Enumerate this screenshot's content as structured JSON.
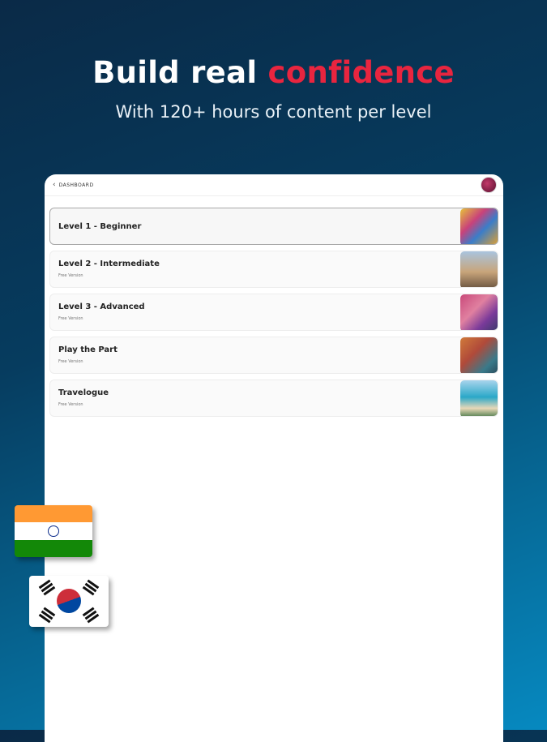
{
  "headline": {
    "main": "Build real ",
    "accent": "confidence"
  },
  "subline": "With 120+ hours of content per level",
  "device": {
    "back_label": "DASHBOARD",
    "items": [
      {
        "title": "Level 1 - Beginner",
        "subtitle": ""
      },
      {
        "title": "Level 2 - Intermediate",
        "subtitle": "Free Version"
      },
      {
        "title": "Level 3 - Advanced",
        "subtitle": "Free Version"
      },
      {
        "title": "Play the Part",
        "subtitle": "Free Version"
      },
      {
        "title": "Travelogue",
        "subtitle": "Free Version"
      }
    ]
  },
  "colors": {
    "accent": "#e8253f",
    "bg_top": "#0a2a47",
    "bg_bottom": "#0689c0"
  },
  "icons": {
    "back": "chevron-left-icon",
    "avatar": "user-avatar",
    "flags": [
      "india-flag-icon",
      "south-korea-flag-icon"
    ]
  }
}
